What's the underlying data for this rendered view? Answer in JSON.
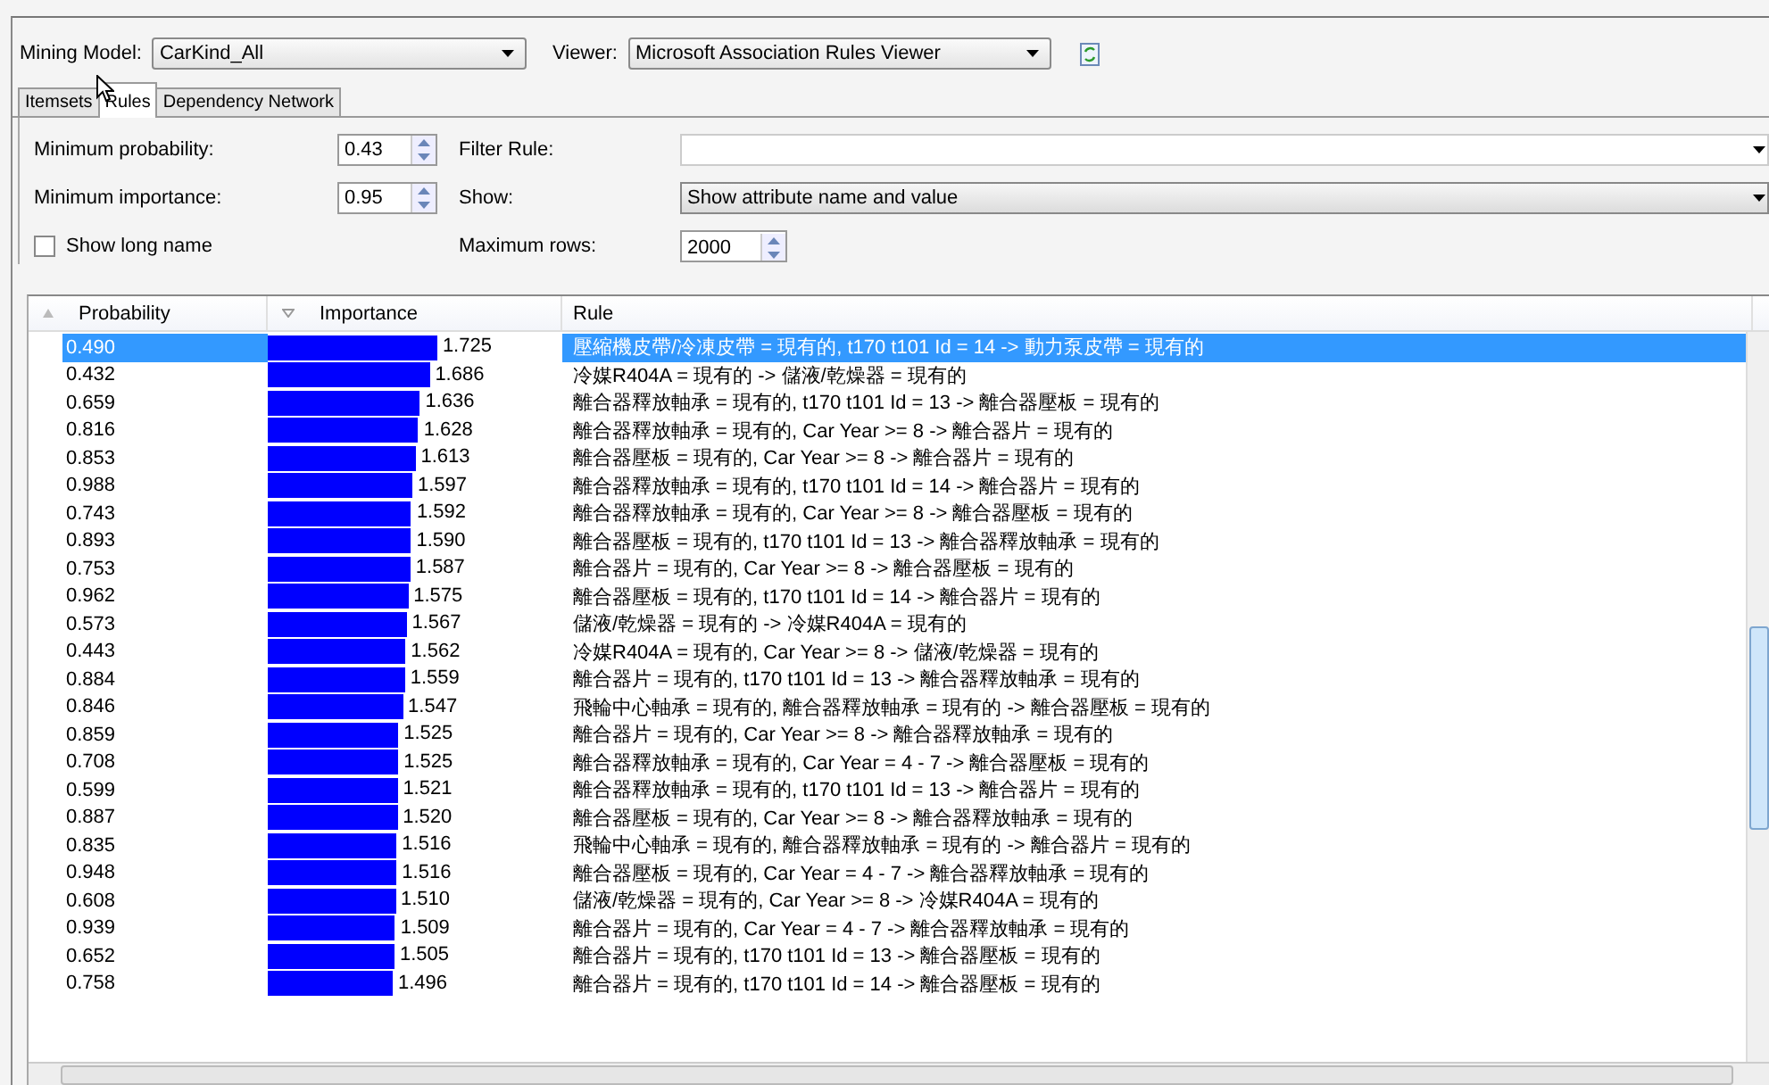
{
  "header": {
    "model_label": "Mining Model:",
    "model_value": "CarKind_All",
    "viewer_label": "Viewer:",
    "viewer_value": "Microsoft Association Rules Viewer"
  },
  "tabs": [
    {
      "label": "Itemsets",
      "selected": false
    },
    {
      "label": "Rules",
      "selected": true
    },
    {
      "label": "Dependency Network",
      "selected": false
    }
  ],
  "filters": {
    "min_probability_label": "Minimum probability:",
    "min_probability": "0.43",
    "min_importance_label": "Minimum importance:",
    "min_importance": "0.95",
    "long_name_label": "Show long name",
    "long_name_checked": false,
    "filter_rule_label": "Filter Rule:",
    "show_label": "Show:",
    "show_value": "Show attribute name and value",
    "max_rows_label": "Maximum rows:",
    "max_rows": "2000"
  },
  "table": {
    "columns": [
      "Probability",
      "Importance",
      "Rule"
    ],
    "rows": [
      {
        "probability": "0.490",
        "importance": "1.725",
        "rule": "壓縮機皮帶/冷凍皮帶 = 現有的, t170 t101 Id = 14 -> 動力泵皮帶 = 現有的",
        "selected": true
      },
      {
        "probability": "0.432",
        "importance": "1.686",
        "rule": "冷媒R404A = 現有的 -> 儲液/乾燥器 = 現有的",
        "selected": false
      },
      {
        "probability": "0.659",
        "importance": "1.636",
        "rule": "離合器釋放軸承 = 現有的, t170 t101 Id = 13 -> 離合器壓板 = 現有的",
        "selected": false
      },
      {
        "probability": "0.816",
        "importance": "1.628",
        "rule": "離合器釋放軸承 = 現有的, Car Year >= 8 -> 離合器片 = 現有的",
        "selected": false
      },
      {
        "probability": "0.853",
        "importance": "1.613",
        "rule": "離合器壓板 = 現有的, Car Year >= 8 -> 離合器片 = 現有的",
        "selected": false
      },
      {
        "probability": "0.988",
        "importance": "1.597",
        "rule": "離合器釋放軸承 = 現有的, t170 t101 Id = 14 -> 離合器片 = 現有的",
        "selected": false
      },
      {
        "probability": "0.743",
        "importance": "1.592",
        "rule": "離合器釋放軸承 = 現有的, Car Year >= 8 -> 離合器壓板 = 現有的",
        "selected": false
      },
      {
        "probability": "0.893",
        "importance": "1.590",
        "rule": "離合器壓板 = 現有的, t170 t101 Id = 13 -> 離合器釋放軸承 = 現有的",
        "selected": false
      },
      {
        "probability": "0.753",
        "importance": "1.587",
        "rule": "離合器片 = 現有的, Car Year >= 8 -> 離合器壓板 = 現有的",
        "selected": false
      },
      {
        "probability": "0.962",
        "importance": "1.575",
        "rule": "離合器壓板 = 現有的, t170 t101 Id = 14 -> 離合器片 = 現有的",
        "selected": false
      },
      {
        "probability": "0.573",
        "importance": "1.567",
        "rule": "儲液/乾燥器 = 現有的 -> 冷媒R404A = 現有的",
        "selected": false
      },
      {
        "probability": "0.443",
        "importance": "1.562",
        "rule": "冷媒R404A = 現有的, Car Year >= 8 -> 儲液/乾燥器 = 現有的",
        "selected": false
      },
      {
        "probability": "0.884",
        "importance": "1.559",
        "rule": "離合器片 = 現有的, t170 t101 Id = 13 -> 離合器釋放軸承 = 現有的",
        "selected": false
      },
      {
        "probability": "0.846",
        "importance": "1.547",
        "rule": "飛輪中心軸承 = 現有的, 離合器釋放軸承 = 現有的 -> 離合器壓板 = 現有的",
        "selected": false
      },
      {
        "probability": "0.859",
        "importance": "1.525",
        "rule": "離合器片 = 現有的, Car Year >= 8 -> 離合器釋放軸承 = 現有的",
        "selected": false
      },
      {
        "probability": "0.708",
        "importance": "1.525",
        "rule": "離合器釋放軸承 = 現有的, Car Year = 4 - 7 -> 離合器壓板 = 現有的",
        "selected": false
      },
      {
        "probability": "0.599",
        "importance": "1.521",
        "rule": "離合器釋放軸承 = 現有的, t170 t101 Id = 13 -> 離合器片 = 現有的",
        "selected": false
      },
      {
        "probability": "0.887",
        "importance": "1.520",
        "rule": "離合器壓板 = 現有的, Car Year >= 8 -> 離合器釋放軸承 = 現有的",
        "selected": false
      },
      {
        "probability": "0.835",
        "importance": "1.516",
        "rule": "飛輪中心軸承 = 現有的, 離合器釋放軸承 = 現有的 -> 離合器片 = 現有的",
        "selected": false
      },
      {
        "probability": "0.948",
        "importance": "1.516",
        "rule": "離合器壓板 = 現有的, Car Year = 4 - 7 -> 離合器釋放軸承 = 現有的",
        "selected": false
      },
      {
        "probability": "0.608",
        "importance": "1.510",
        "rule": "儲液/乾燥器 = 現有的, Car Year >= 8 -> 冷媒R404A = 現有的",
        "selected": false
      },
      {
        "probability": "0.939",
        "importance": "1.509",
        "rule": "離合器片 = 現有的, Car Year = 4 - 7 -> 離合器釋放軸承 = 現有的",
        "selected": false
      },
      {
        "probability": "0.652",
        "importance": "1.505",
        "rule": "離合器片 = 現有的, t170 t101 Id = 13 -> 離合器壓板 = 現有的",
        "selected": false
      },
      {
        "probability": "0.758",
        "importance": "1.496",
        "rule": "離合器片 = 現有的, t170 t101 Id = 14 -> 離合器壓板 = 現有的",
        "selected": false
      }
    ]
  }
}
